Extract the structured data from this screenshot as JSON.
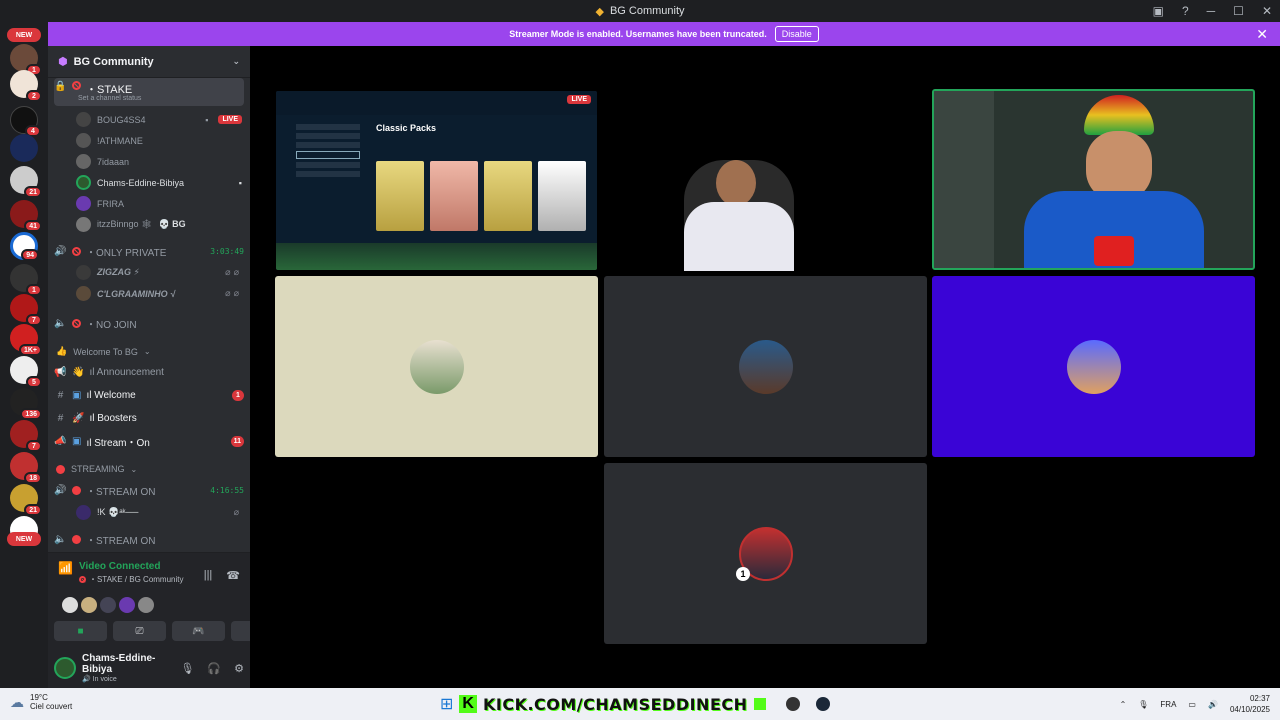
{
  "window": {
    "title": "BG Community"
  },
  "banner": {
    "text": "Streamer Mode is enabled. Usernames have been truncated.",
    "button": "Disable"
  },
  "server_rail": {
    "top_pill": "NEW",
    "bottom_pill": "NEW",
    "badges": [
      "1",
      "2",
      "4",
      "21",
      "41",
      "94",
      "1",
      "7",
      "1K+",
      "5",
      "136",
      "7",
      "18",
      "21"
    ]
  },
  "guild": {
    "name": "BG Community"
  },
  "channels": {
    "stake": {
      "name": "・STAKE",
      "status": "Set a channel status"
    },
    "stake_users": [
      {
        "name": "BOUG4SS4",
        "badge": "LIVE"
      },
      {
        "name": "!ATHMANE"
      },
      {
        "name": "7idaaan"
      },
      {
        "name": "Chams-Eddine-Bibiya"
      },
      {
        "name": "FRIRA"
      },
      {
        "name": "itzzBinngo 🕸",
        "tag": "💀 BG"
      }
    ],
    "only_private": {
      "name": "・ONLY PRIVATE",
      "timer": "3:03:49"
    },
    "private_users": [
      {
        "name": "ZIGZAG ⚡"
      },
      {
        "name": "C'LGRAAMINHO √"
      }
    ],
    "no_join": {
      "name": "・NO JOIN"
    },
    "cat_welcome": "Welcome To BG",
    "announcement": "ıl Announcement",
    "welcome": {
      "name": "ıl Welcome",
      "mentions": "1"
    },
    "boosters": {
      "name": "ıl Boosters"
    },
    "stream_on_text": {
      "name": "ıl Stream・On",
      "mentions": "11"
    },
    "cat_streaming": "STREAMING",
    "stream_on_1": {
      "name": "・STREAM ON",
      "timer": "4:16:55"
    },
    "stream_user": {
      "name": "!K 💀ᵃᵏ──"
    },
    "stream_on_2": {
      "name": "・STREAM ON"
    }
  },
  "voice": {
    "status": "Video Connected",
    "channel": "・STAKE / BG Community",
    "me": {
      "name": "Chams-Eddine-Bibiya",
      "sub": "In voice"
    }
  },
  "stage": {
    "screen_title": "Classic Packs",
    "live_badge": "LIVE",
    "number_badge": "1"
  },
  "colors": {
    "accent": "#9b45ed",
    "live": "#da373c",
    "online": "#23a55a",
    "tile_beige": "#dcd9bd",
    "tile_blue": "#3a04d6",
    "tile_dark": "#2b2d31"
  },
  "taskbar": {
    "temp": "19°C",
    "condition": "Ciel couvert",
    "kick_url": "KICK.COM/CHAMSEDDINECH",
    "lang": "FRA",
    "time": "02:37",
    "date": "04/10/2025"
  }
}
